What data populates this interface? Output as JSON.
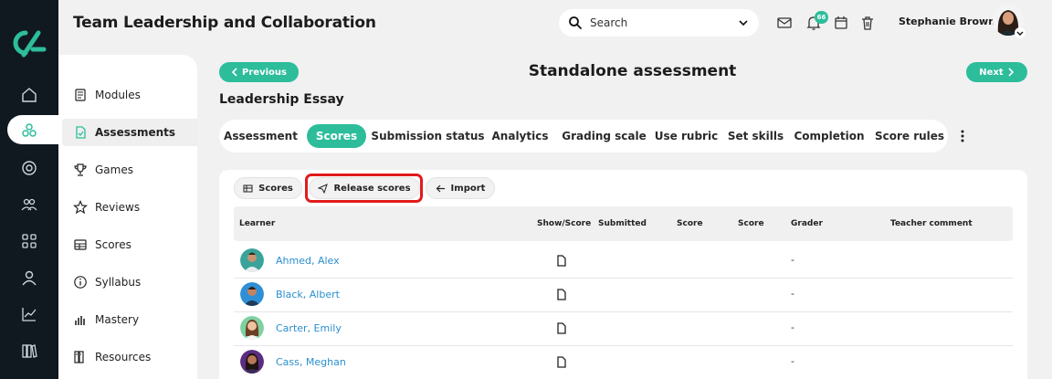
{
  "app": {
    "title": "Team Leadership and Collaboration"
  },
  "search": {
    "placeholder": "Search"
  },
  "header": {
    "notification_count": "66",
    "user_name": "Stephanie Brown"
  },
  "rail": {
    "icons": [
      "logo",
      "home-icon",
      "modules-active-icon",
      "target-icon",
      "people-icon",
      "grid-icon",
      "user-icon",
      "chart-icon",
      "library-icon"
    ]
  },
  "sidebar": {
    "items": [
      {
        "label": "Modules",
        "icon": "document-list-icon"
      },
      {
        "label": "Assessments",
        "icon": "assessment-icon",
        "active": true
      },
      {
        "label": "Games",
        "icon": "trophy-icon"
      },
      {
        "label": "Reviews",
        "icon": "star-icon"
      },
      {
        "label": "Scores",
        "icon": "table-icon"
      },
      {
        "label": "Syllabus",
        "icon": "info-icon"
      },
      {
        "label": "Mastery",
        "icon": "bar-chart-icon"
      },
      {
        "label": "Resources",
        "icon": "books-icon"
      }
    ]
  },
  "nav": {
    "previous_label": "Previous",
    "next_label": "Next"
  },
  "page": {
    "title": "Standalone assessment",
    "section": "Leadership Essay"
  },
  "tabs": [
    "Assessment",
    "Scores",
    "Submission status",
    "Analytics",
    "Grading scale",
    "Use rubric",
    "Set skills",
    "Completion",
    "Score rules"
  ],
  "active_tab": "Scores",
  "toolbar": {
    "scores_label": "Scores",
    "release_label": "Release scores",
    "import_label": "Import"
  },
  "table": {
    "columns": [
      "Learner",
      "Show/Score",
      "Submitted",
      "Score",
      "Score",
      "Grader",
      "Teacher comment"
    ],
    "rows": [
      {
        "name": "Ahmed, Alex",
        "grader": "-"
      },
      {
        "name": "Black, Albert",
        "grader": "-"
      },
      {
        "name": "Carter, Emily",
        "grader": "-"
      },
      {
        "name": "Cass, Meghan",
        "grader": "-"
      }
    ]
  },
  "colors": {
    "accent": "#2dbd9b",
    "rail": "#101820",
    "highlight": "#e11b1b",
    "link": "#2a8fcf"
  }
}
